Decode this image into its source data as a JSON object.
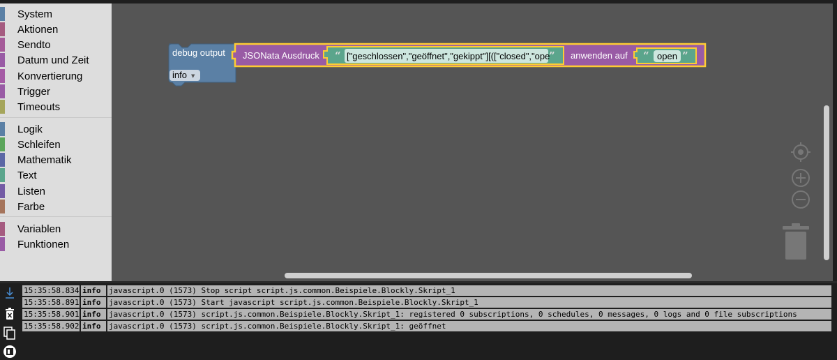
{
  "toolbox": {
    "categories": [
      {
        "label": "System",
        "color": "#5b80a5"
      },
      {
        "label": "Aktionen",
        "color": "#a55b80"
      },
      {
        "label": "Sendto",
        "color": "#a55b99"
      },
      {
        "label": "Datum und Zeit",
        "color": "#995ba5"
      },
      {
        "label": "Konvertierung",
        "color": "#a55ba5"
      },
      {
        "label": "Trigger",
        "color": "#995ba5"
      },
      {
        "label": "Timeouts",
        "color": "#a5a55b"
      },
      {
        "label": "Logik",
        "color": "#5b80a5"
      },
      {
        "label": "Schleifen",
        "color": "#5ba55b"
      },
      {
        "label": "Mathematik",
        "color": "#5b67a5"
      },
      {
        "label": "Text",
        "color": "#5ba58c"
      },
      {
        "label": "Listen",
        "color": "#745ba5"
      },
      {
        "label": "Farbe",
        "color": "#a5745b"
      },
      {
        "label": "Variablen",
        "color": "#a55b80"
      },
      {
        "label": "Funktionen",
        "color": "#995ba5"
      }
    ]
  },
  "blocks": {
    "debug_label": "debug output",
    "debug_level": "info",
    "jsonata_label": "JSONata Ausdruck",
    "expression": "[\"geschlossen\",\"geöffnet\",\"gekippt\"][([\"closed\",\"ope",
    "apply_label": "anwenden auf",
    "input_value": "open",
    "colors": {
      "debug": "#5b80a5",
      "jsonata": "#995ba5",
      "text": "#5ba58c",
      "highlight": "#fc3"
    }
  },
  "log": {
    "rows": [
      {
        "time": "15:35:58.834",
        "severity": "info",
        "message": "javascript.0 (1573) Stop script script.js.common.Beispiele.Blockly.Skript_1"
      },
      {
        "time": "15:35:58.891",
        "severity": "info",
        "message": "javascript.0 (1573) Start javascript script.js.common.Beispiele.Blockly.Skript_1"
      },
      {
        "time": "15:35:58.901",
        "severity": "info",
        "message": "javascript.0 (1573) script.js.common.Beispiele.Blockly.Skript_1: registered 0 subscriptions, 0 schedules, 0 messages, 0 logs and 0 file subscriptions"
      },
      {
        "time": "15:35:58.902",
        "severity": "info",
        "message": "javascript.0 (1573) script.js.common.Beispiele.Blockly.Skript_1: geöffnet"
      }
    ]
  }
}
